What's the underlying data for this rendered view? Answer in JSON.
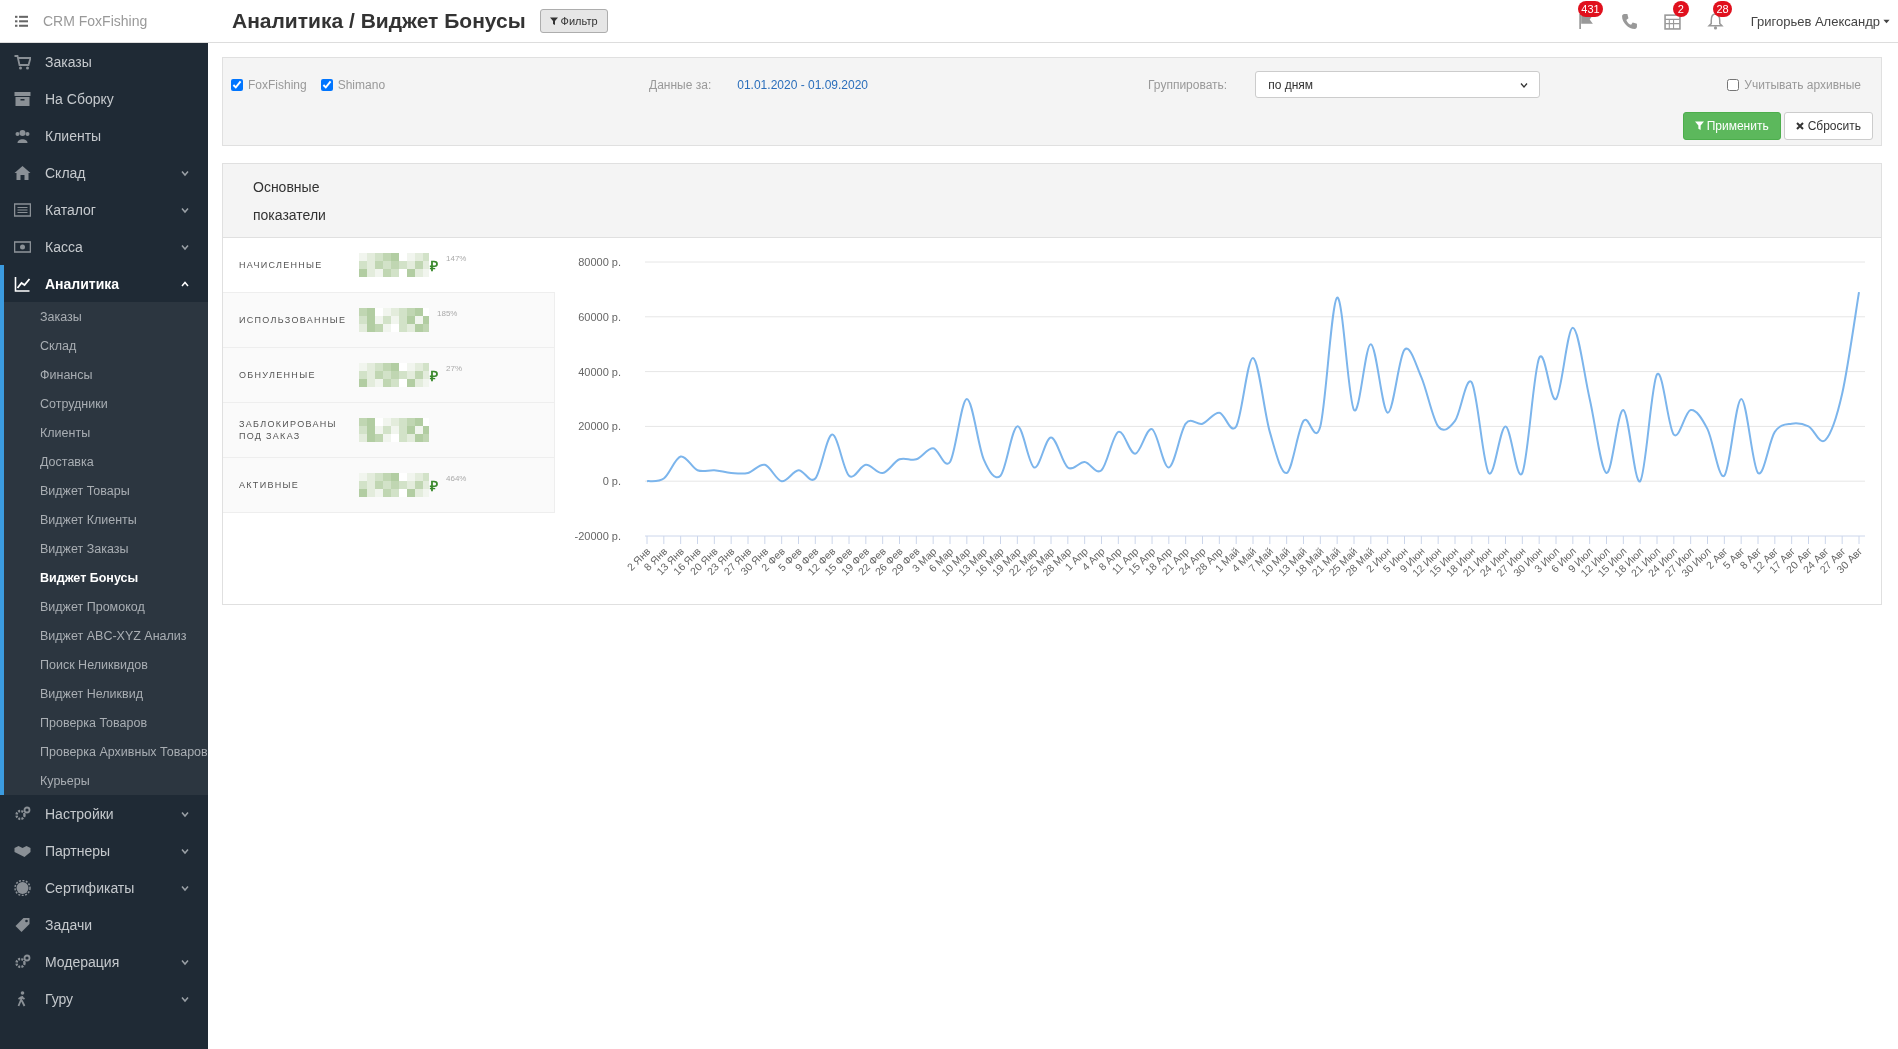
{
  "header": {
    "brand": "CRM FoxFishing",
    "title": "Аналитика / Виджет Бонусы",
    "filter_button": "Фильтр",
    "notifications": [
      {
        "kind": "flag",
        "badge": "431"
      },
      {
        "kind": "phone"
      },
      {
        "kind": "calendar",
        "badge": "2"
      },
      {
        "kind": "bell",
        "badge": "28"
      }
    ],
    "user": "Григорьев Александр"
  },
  "sidebar": {
    "items": [
      {
        "label": "Заказы",
        "kind": "link"
      },
      {
        "label": "На Сборку",
        "kind": "link"
      },
      {
        "label": "Клиенты",
        "kind": "link"
      },
      {
        "label": "Склад",
        "kind": "group",
        "expanded": false
      },
      {
        "label": "Каталог",
        "kind": "group",
        "expanded": false
      },
      {
        "label": "Касса",
        "kind": "group",
        "expanded": false
      },
      {
        "label": "Аналитика",
        "kind": "group",
        "expanded": true,
        "children": [
          {
            "label": "Заказы",
            "selected": false
          },
          {
            "label": "Склад",
            "selected": false
          },
          {
            "label": "Финансы",
            "selected": false
          },
          {
            "label": "Сотрудники",
            "selected": false
          },
          {
            "label": "Клиенты",
            "selected": false
          },
          {
            "label": "Доставка",
            "selected": false
          },
          {
            "label": "Виджет Товары",
            "selected": false
          },
          {
            "label": "Виджет Клиенты",
            "selected": false
          },
          {
            "label": "Виджет Заказы",
            "selected": false
          },
          {
            "label": "Виджет Бонусы",
            "selected": true
          },
          {
            "label": "Виджет Промокод",
            "selected": false
          },
          {
            "label": "Виджет ABC-XYZ Анализ",
            "selected": false
          },
          {
            "label": "Поиск Неликвидов",
            "selected": false
          },
          {
            "label": "Виджет Неликвид",
            "selected": false
          },
          {
            "label": "Проверка Товаров",
            "selected": false
          },
          {
            "label": "Проверка Архивных Товаров",
            "selected": false
          },
          {
            "label": "Курьеры",
            "selected": false
          }
        ]
      },
      {
        "label": "Настройки",
        "kind": "group",
        "expanded": false
      },
      {
        "label": "Партнеры",
        "kind": "group",
        "expanded": false
      },
      {
        "label": "Сертификаты",
        "kind": "group",
        "expanded": false
      },
      {
        "label": "Задачи",
        "kind": "link"
      },
      {
        "label": "Модерация",
        "kind": "group",
        "expanded": false
      },
      {
        "label": "Гуру",
        "kind": "group",
        "expanded": false
      }
    ]
  },
  "filter": {
    "stores": [
      {
        "label": "FoxFishing",
        "checked": true
      },
      {
        "label": "Shimano",
        "checked": true
      }
    ],
    "period_label": "Данные за:",
    "period": "01.01.2020 - 01.09.2020",
    "group_label": "Группировать:",
    "group_value": "по дням",
    "archive": {
      "label": "Учитывать архивные",
      "checked": false
    },
    "apply_button": "Применить",
    "reset_button": "Сбросить"
  },
  "panel": {
    "title_lines": [
      "Основные",
      "показатели"
    ],
    "metrics": [
      {
        "label": "НАЧИСЛЕННЫЕ",
        "currency": "₽",
        "percent": "147%"
      },
      {
        "label": "ИСПОЛЬЗОВАННЫЕ",
        "percent": "185%"
      },
      {
        "label": "ОБНУЛЕННЫЕ",
        "currency": "₽",
        "percent": "27%"
      },
      {
        "label": "ЗАБЛОКИРОВАНЫ ПОД ЗАКАЗ"
      },
      {
        "label": "АКТИВНЫЕ",
        "currency": "₽",
        "percent": "464%"
      }
    ]
  },
  "chart": {
    "chart_data": {
      "type": "line",
      "categories": [
        "2 Янв",
        "8 Янв",
        "13 Янв",
        "16 Янв",
        "20 Янв",
        "23 Янв",
        "27 Янв",
        "30 Янв",
        "2 Фев",
        "5 Фев",
        "9 Фев",
        "12 Фев",
        "15 Фев",
        "19 Фев",
        "22 Фев",
        "26 Фев",
        "29 Фев",
        "3 Мар",
        "6 Мар",
        "10 Мар",
        "13 Мар",
        "16 Мар",
        "19 Мар",
        "22 Мар",
        "25 Мар",
        "28 Мар",
        "1 Апр",
        "4 Апр",
        "8 Апр",
        "11 Апр",
        "15 Апр",
        "18 Апр",
        "21 Апр",
        "24 Апр",
        "28 Апр",
        "1 Май",
        "4 Май",
        "7 Май",
        "10 Май",
        "13 Май",
        "18 Май",
        "21 Май",
        "25 Май",
        "28 Май",
        "2 Июн",
        "5 Июн",
        "9 Июн",
        "12 Июн",
        "15 Июн",
        "18 Июн",
        "21 Июн",
        "24 Июн",
        "27 Июн",
        "30 Июн",
        "3 Июл",
        "6 Июл",
        "9 Июл",
        "12 Июл",
        "15 Июл",
        "18 Июл",
        "21 Июл",
        "24 Июл",
        "27 Июл",
        "30 Июл",
        "2 Авг",
        "5 Авг",
        "8 Авг",
        "12 Авг",
        "17 Авг",
        "20 Авг",
        "24 Авг",
        "27 Авг",
        "30 Авг"
      ],
      "grid": true,
      "series": [
        {
          "color": "#7cb5ec",
          "values": [
            0,
            1000,
            9000,
            4000,
            4000,
            3000,
            3000,
            6000,
            0,
            4000,
            1000,
            17000,
            2000,
            6000,
            3000,
            8000,
            8000,
            12000,
            7000,
            30000,
            8000,
            2000,
            20000,
            5000,
            16000,
            5000,
            7000,
            4000,
            18000,
            10000,
            19000,
            5000,
            21000,
            21000,
            25000,
            20000,
            45000,
            18000,
            3000,
            22000,
            20000,
            67000,
            26000,
            50000,
            25000,
            48000,
            38000,
            20000,
            22000,
            36000,
            3000,
            20000,
            3000,
            45000,
            30000,
            56000,
            30000,
            3000,
            26000,
            0,
            39000,
            17000,
            26000,
            19000,
            2000,
            30000,
            3000,
            18000,
            21000,
            20000,
            15000,
            32000,
            69000
          ]
        }
      ],
      "ylim": [
        -20000,
        80000
      ],
      "yticks": [
        {
          "value": -20000,
          "label": "-20000 р."
        },
        {
          "value": 0,
          "label": "0 р."
        },
        {
          "value": 20000,
          "label": "20000 р."
        },
        {
          "value": 40000,
          "label": "40000 р."
        },
        {
          "value": 60000,
          "label": "60000 р."
        },
        {
          "value": 80000,
          "label": "80000 р."
        }
      ]
    }
  }
}
